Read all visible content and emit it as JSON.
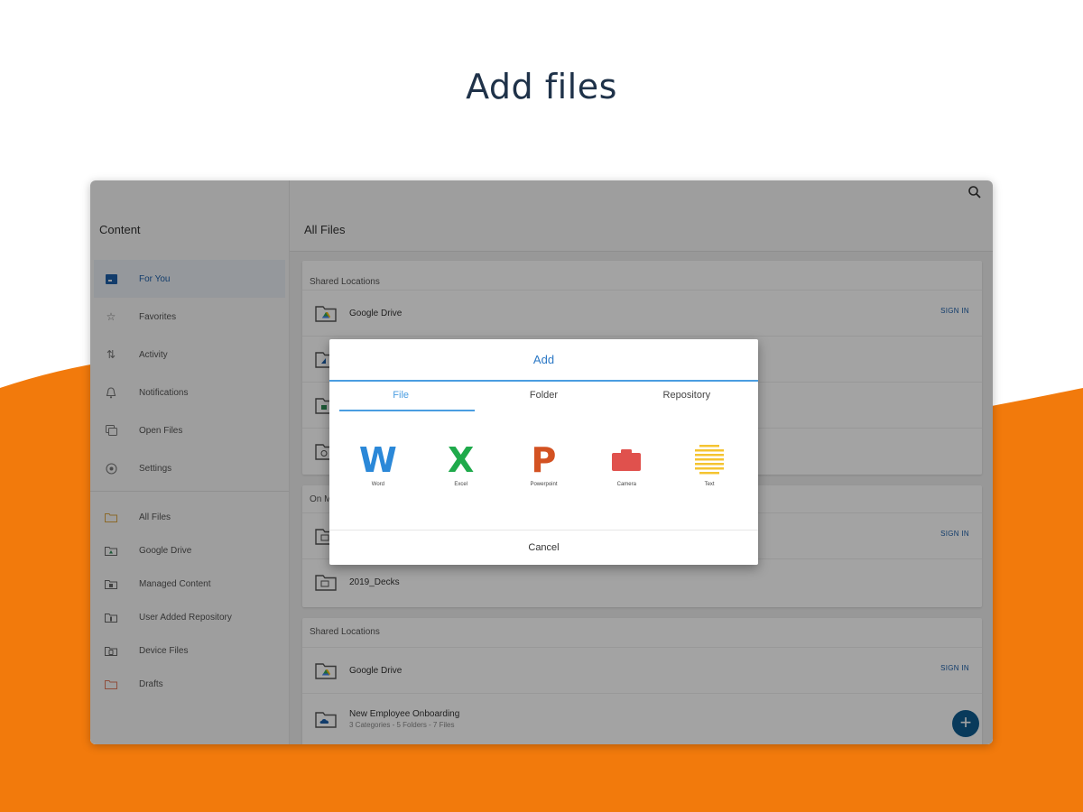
{
  "headline": "Add files",
  "colors": {
    "accent_orange": "#f27a0c",
    "headline": "#1f3249",
    "brand_blue": "#1d5fa8",
    "dialog_blue": "#4a9de1"
  },
  "sidebar": {
    "title": "Content",
    "items": [
      {
        "label": "For You",
        "icon": "for-you-icon",
        "active": true
      },
      {
        "label": "Favorites",
        "icon": "star-icon"
      },
      {
        "label": "Activity",
        "icon": "activity-icon"
      },
      {
        "label": "Notifications",
        "icon": "bell-icon"
      },
      {
        "label": "Open Files",
        "icon": "open-files-icon"
      },
      {
        "label": "Settings",
        "icon": "gear-icon"
      }
    ],
    "locations": [
      {
        "label": "All Files",
        "icon": "folder-icon"
      },
      {
        "label": "Google Drive",
        "icon": "google-drive-folder-icon"
      },
      {
        "label": "Managed Content",
        "icon": "managed-content-icon"
      },
      {
        "label": "User Added Repository",
        "icon": "repository-icon"
      },
      {
        "label": "Device Files",
        "icon": "device-files-icon"
      },
      {
        "label": "Drafts",
        "icon": "drafts-icon"
      }
    ]
  },
  "header": {
    "title": "All Files",
    "search_icon": "search-icon"
  },
  "sections": [
    {
      "title": "Shared Locations",
      "rows": [
        {
          "label": "Google Drive",
          "action": "SIGN IN"
        },
        {
          "label": "",
          "action": ""
        },
        {
          "label": "",
          "action": ""
        },
        {
          "label": "",
          "action": ""
        }
      ]
    },
    {
      "title": "On M",
      "rows": [
        {
          "label": "",
          "action": "SIGN IN"
        },
        {
          "label": "2019_Decks",
          "action": ""
        }
      ]
    },
    {
      "title": "Shared Locations",
      "rows": [
        {
          "label": "Google Drive",
          "action": "SIGN IN"
        },
        {
          "label": "New Employee Onboarding",
          "sub": "3 Categories - 5 Folders - 7 Files",
          "action": ""
        }
      ]
    }
  ],
  "fab_label": "+",
  "dialog": {
    "title": "Add",
    "tabs": [
      "File",
      "Folder",
      "Repository"
    ],
    "active_tab": "File",
    "file_types": [
      {
        "glyph": "W",
        "label": "Word",
        "color": "#2b88d8"
      },
      {
        "glyph": "X",
        "label": "Excel",
        "color": "#1faa4b"
      },
      {
        "glyph": "P",
        "label": "Powerpoint",
        "color": "#d35222"
      },
      {
        "glyph": "",
        "label": "Camera",
        "color": "#e0514d",
        "icon": "camera-icon"
      },
      {
        "glyph": "",
        "label": "Text",
        "color": "#f5c431",
        "icon": "text-icon"
      }
    ],
    "cancel": "Cancel"
  }
}
